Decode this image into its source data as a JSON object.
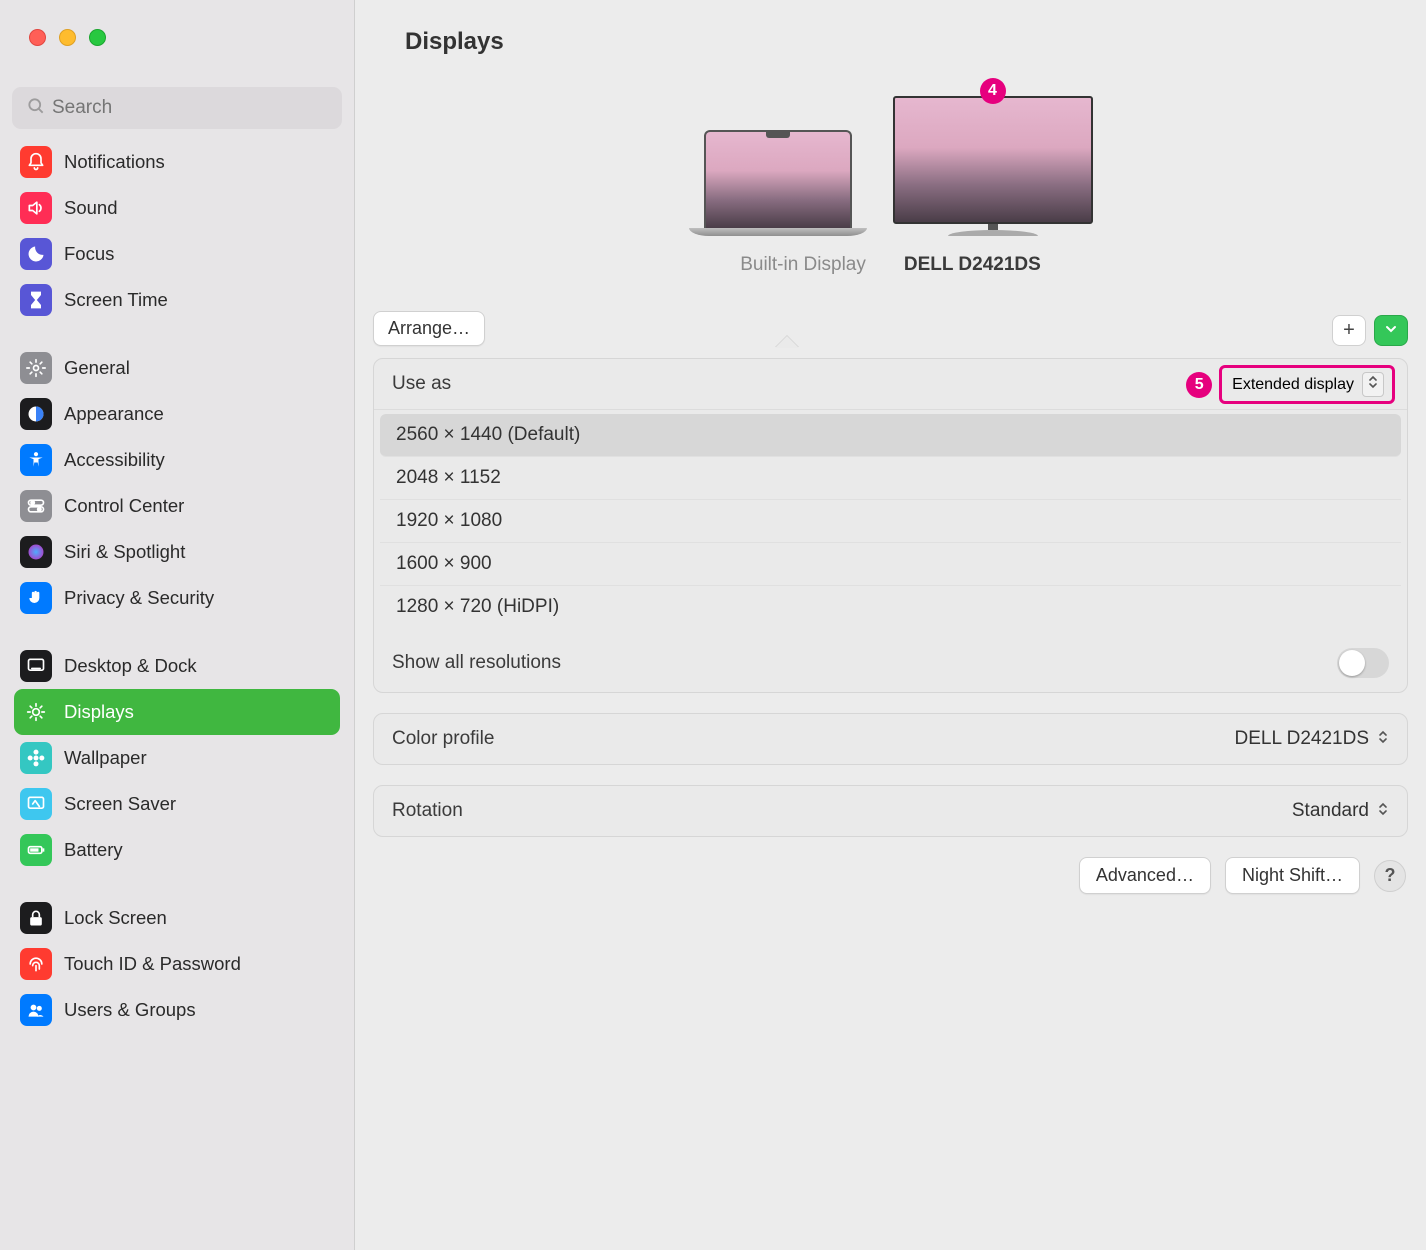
{
  "window": {
    "title": "Displays"
  },
  "search": {
    "placeholder": "Search"
  },
  "sidebar": {
    "groups": [
      {
        "items": [
          {
            "label": "Notifications",
            "icon": "bell",
            "bg": "#ff3b30"
          },
          {
            "label": "Sound",
            "icon": "sound",
            "bg": "#ff2d55"
          },
          {
            "label": "Focus",
            "icon": "moon",
            "bg": "#5856d6"
          },
          {
            "label": "Screen Time",
            "icon": "hourglass",
            "bg": "#5856d6"
          }
        ]
      },
      {
        "items": [
          {
            "label": "General",
            "icon": "gear",
            "bg": "#8e8e93"
          },
          {
            "label": "Appearance",
            "icon": "appearance",
            "bg": "#1c1c1e"
          },
          {
            "label": "Accessibility",
            "icon": "accessibility",
            "bg": "#007aff"
          },
          {
            "label": "Control Center",
            "icon": "controlcenter",
            "bg": "#8e8e93"
          },
          {
            "label": "Siri & Spotlight",
            "icon": "siri",
            "bg": "#1c1c1e"
          },
          {
            "label": "Privacy & Security",
            "icon": "hand",
            "bg": "#007aff"
          }
        ]
      },
      {
        "items": [
          {
            "label": "Desktop & Dock",
            "icon": "dock",
            "bg": "#1c1c1e"
          },
          {
            "label": "Displays",
            "icon": "brightness",
            "bg": "#40b740",
            "active": true
          },
          {
            "label": "Wallpaper",
            "icon": "flower",
            "bg": "#34c7c2"
          },
          {
            "label": "Screen Saver",
            "icon": "screensaver",
            "bg": "#3ec7ef"
          },
          {
            "label": "Battery",
            "icon": "battery",
            "bg": "#34c759"
          }
        ]
      },
      {
        "items": [
          {
            "label": "Lock Screen",
            "icon": "lock",
            "bg": "#1c1c1e"
          },
          {
            "label": "Touch ID & Password",
            "icon": "fingerprint",
            "bg": "#ff3b30"
          },
          {
            "label": "Users & Groups",
            "icon": "users",
            "bg": "#007aff"
          }
        ]
      }
    ]
  },
  "annotations": {
    "badge4": "4",
    "badge5": "5"
  },
  "displays": {
    "arrange": "Arrange…",
    "builtin_label": "Built-in Display",
    "external_label": "DELL D2421DS"
  },
  "settings": {
    "use_as_label": "Use as",
    "use_as_value": "Extended display",
    "resolutions": [
      "2560 × 1440 (Default)",
      "2048 × 1152",
      "1920 × 1080",
      "1600 × 900",
      "1280 × 720 (HiDPI)"
    ],
    "show_all_label": "Show all resolutions",
    "color_profile_label": "Color profile",
    "color_profile_value": "DELL D2421DS",
    "rotation_label": "Rotation",
    "rotation_value": "Standard",
    "advanced": "Advanced…",
    "night_shift": "Night Shift…",
    "help": "?"
  }
}
